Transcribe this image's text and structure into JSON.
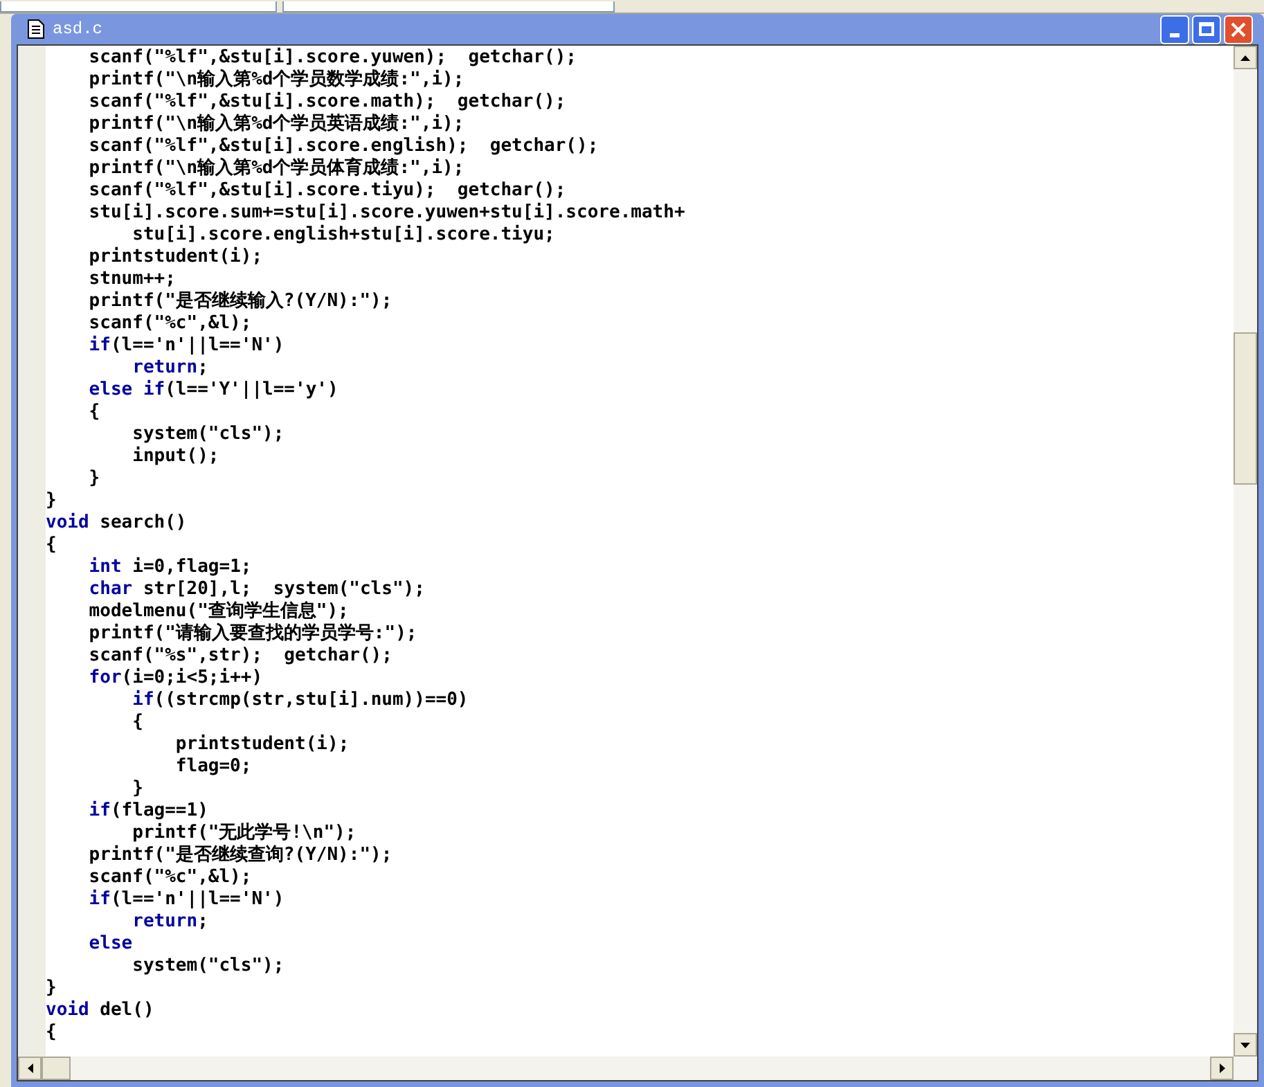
{
  "window": {
    "title": "asd.c"
  },
  "code_lines": [
    {
      "segments": [
        {
          "kind": "plain",
          "text": "    scanf(\"%lf\",&stu[i].score.yuwen);  getchar();"
        }
      ]
    },
    {
      "segments": [
        {
          "kind": "plain",
          "text": "    printf(\"\\n输入第%d个学员数学成绩:\",i);"
        }
      ]
    },
    {
      "segments": [
        {
          "kind": "plain",
          "text": "    scanf(\"%lf\",&stu[i].score.math);  getchar();"
        }
      ]
    },
    {
      "segments": [
        {
          "kind": "plain",
          "text": "    printf(\"\\n输入第%d个学员英语成绩:\",i);"
        }
      ]
    },
    {
      "segments": [
        {
          "kind": "plain",
          "text": "    scanf(\"%lf\",&stu[i].score.english);  getchar();"
        }
      ]
    },
    {
      "segments": [
        {
          "kind": "plain",
          "text": "    printf(\"\\n输入第%d个学员体育成绩:\",i);"
        }
      ]
    },
    {
      "segments": [
        {
          "kind": "plain",
          "text": "    scanf(\"%lf\",&stu[i].score.tiyu);  getchar();"
        }
      ]
    },
    {
      "segments": [
        {
          "kind": "plain",
          "text": "    stu[i].score.sum+=stu[i].score.yuwen+stu[i].score.math+"
        }
      ]
    },
    {
      "segments": [
        {
          "kind": "plain",
          "text": "        stu[i].score.english+stu[i].score.tiyu;"
        }
      ]
    },
    {
      "segments": [
        {
          "kind": "plain",
          "text": "    printstudent(i);"
        }
      ]
    },
    {
      "segments": [
        {
          "kind": "plain",
          "text": "    stnum++;"
        }
      ]
    },
    {
      "segments": [
        {
          "kind": "plain",
          "text": "    printf(\"是否继续输入?(Y/N):\");"
        }
      ]
    },
    {
      "segments": [
        {
          "kind": "plain",
          "text": "    scanf(\"%c\",&l);"
        }
      ]
    },
    {
      "segments": [
        {
          "kind": "keyword",
          "text": "    if"
        },
        {
          "kind": "plain",
          "text": "(l=='n'||l=='N')"
        }
      ]
    },
    {
      "segments": [
        {
          "kind": "keyword",
          "text": "        return"
        },
        {
          "kind": "plain",
          "text": ";"
        }
      ]
    },
    {
      "segments": [
        {
          "kind": "keyword",
          "text": "    else if"
        },
        {
          "kind": "plain",
          "text": "(l=='Y'||l=='y')"
        }
      ]
    },
    {
      "segments": [
        {
          "kind": "plain",
          "text": "    {"
        }
      ]
    },
    {
      "segments": [
        {
          "kind": "plain",
          "text": "        system(\"cls\");"
        }
      ]
    },
    {
      "segments": [
        {
          "kind": "plain",
          "text": "        input();"
        }
      ]
    },
    {
      "segments": [
        {
          "kind": "plain",
          "text": "    }"
        }
      ]
    },
    {
      "segments": [
        {
          "kind": "plain",
          "text": "}"
        }
      ]
    },
    {
      "segments": [
        {
          "kind": "keyword",
          "text": "void"
        },
        {
          "kind": "plain",
          "text": " search()"
        }
      ]
    },
    {
      "segments": [
        {
          "kind": "plain",
          "text": "{"
        }
      ]
    },
    {
      "segments": [
        {
          "kind": "keyword",
          "text": "    int"
        },
        {
          "kind": "plain",
          "text": " i=0,flag=1;"
        }
      ]
    },
    {
      "segments": [
        {
          "kind": "keyword",
          "text": "    char"
        },
        {
          "kind": "plain",
          "text": " str[20],l;  system(\"cls\");"
        }
      ]
    },
    {
      "segments": [
        {
          "kind": "plain",
          "text": "    modelmenu(\"查询学生信息\");"
        }
      ]
    },
    {
      "segments": [
        {
          "kind": "plain",
          "text": "    printf(\"请输入要查找的学员学号:\");"
        }
      ]
    },
    {
      "segments": [
        {
          "kind": "plain",
          "text": "    scanf(\"%s\",str);  getchar();"
        }
      ]
    },
    {
      "segments": [
        {
          "kind": "keyword",
          "text": "    for"
        },
        {
          "kind": "plain",
          "text": "(i=0;i<5;i++)"
        }
      ]
    },
    {
      "segments": [
        {
          "kind": "keyword",
          "text": "        if"
        },
        {
          "kind": "plain",
          "text": "((strcmp(str,stu[i].num))==0)"
        }
      ]
    },
    {
      "segments": [
        {
          "kind": "plain",
          "text": "        {"
        }
      ]
    },
    {
      "segments": [
        {
          "kind": "plain",
          "text": "            printstudent(i);"
        }
      ]
    },
    {
      "segments": [
        {
          "kind": "plain",
          "text": "            flag=0;"
        }
      ]
    },
    {
      "segments": [
        {
          "kind": "plain",
          "text": "        }"
        }
      ]
    },
    {
      "segments": [
        {
          "kind": "keyword",
          "text": "    if"
        },
        {
          "kind": "plain",
          "text": "(flag==1)"
        }
      ]
    },
    {
      "segments": [
        {
          "kind": "plain",
          "text": "        printf(\"无此学号!\\n\");"
        }
      ]
    },
    {
      "segments": [
        {
          "kind": "plain",
          "text": "    printf(\"是否继续查询?(Y/N):\");"
        }
      ]
    },
    {
      "segments": [
        {
          "kind": "plain",
          "text": "    scanf(\"%c\",&l);"
        }
      ]
    },
    {
      "segments": [
        {
          "kind": "keyword",
          "text": "    if"
        },
        {
          "kind": "plain",
          "text": "(l=='n'||l=='N')"
        }
      ]
    },
    {
      "segments": [
        {
          "kind": "keyword",
          "text": "        return"
        },
        {
          "kind": "plain",
          "text": ";"
        }
      ]
    },
    {
      "segments": [
        {
          "kind": "keyword",
          "text": "    else"
        }
      ]
    },
    {
      "segments": [
        {
          "kind": "plain",
          "text": "        system(\"cls\");"
        }
      ]
    },
    {
      "segments": [
        {
          "kind": "plain",
          "text": "}"
        }
      ]
    },
    {
      "segments": [
        {
          "kind": "keyword",
          "text": "void"
        },
        {
          "kind": "plain",
          "text": " del()"
        }
      ]
    },
    {
      "segments": [
        {
          "kind": "plain",
          "text": "{"
        }
      ]
    }
  ]
}
